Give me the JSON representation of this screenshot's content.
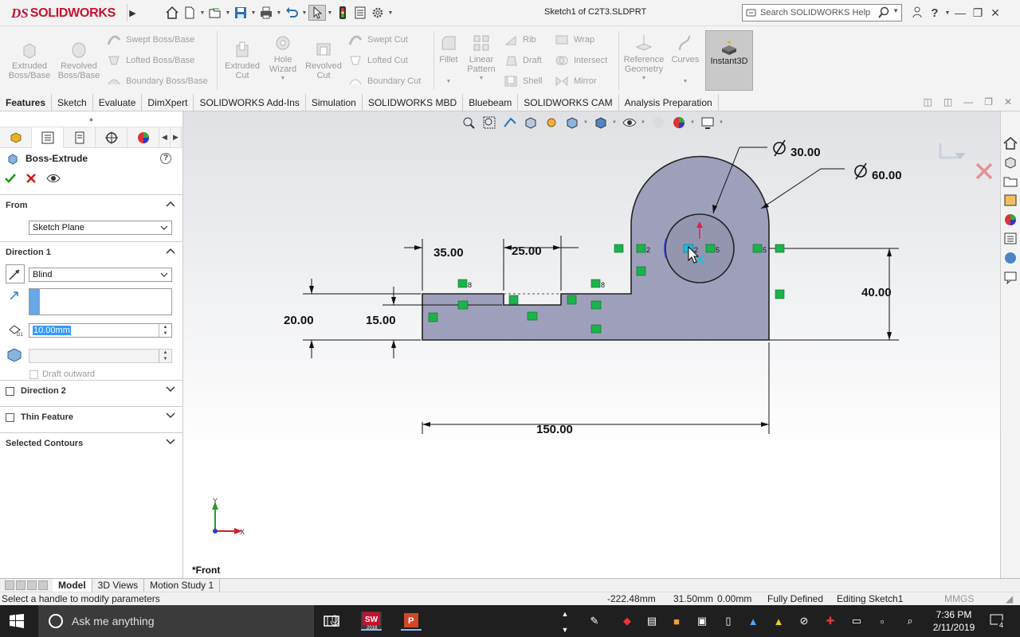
{
  "app": {
    "logo_prefix": "DS",
    "logo_text": "SOLIDWORKS",
    "document_title": "Sketch1 of C2T3.SLDPRT",
    "search_placeholder": "Search SOLIDWORKS Help"
  },
  "commands": {
    "extruded_boss": "Extruded Boss/Base",
    "revolved_boss": "Revolved Boss/Base",
    "swept_boss": "Swept Boss/Base",
    "lofted_boss": "Lofted Boss/Base",
    "boundary_boss": "Boundary Boss/Base",
    "extruded_cut": "Extruded Cut",
    "hole_wizard": "Hole Wizard",
    "revolved_cut": "Revolved Cut",
    "swept_cut": "Swept Cut",
    "lofted_cut": "Lofted Cut",
    "boundary_cut": "Boundary Cut",
    "fillet": "Fillet",
    "linear_pattern": "Linear Pattern",
    "rib": "Rib",
    "draft": "Draft",
    "shell": "Shell",
    "wrap": "Wrap",
    "intersect": "Intersect",
    "mirror": "Mirror",
    "reference_geometry": "Reference Geometry",
    "curves": "Curves",
    "instant3d": "Instant3D"
  },
  "tabs": [
    "Features",
    "Sketch",
    "Evaluate",
    "DimXpert",
    "SOLIDWORKS Add-Ins",
    "Simulation",
    "SOLIDWORKS MBD",
    "Bluebeam",
    "SOLIDWORKS CAM",
    "Analysis Preparation"
  ],
  "property_manager": {
    "title": "Boss-Extrude",
    "from_label": "From",
    "from_value": "Sketch Plane",
    "direction1_label": "Direction 1",
    "end_condition": "Blind",
    "depth": "10.00mm",
    "draft_outward": "Draft outward",
    "direction2_label": "Direction 2",
    "thin_feature_label": "Thin Feature",
    "selected_contours_label": "Selected Contours"
  },
  "sketch": {
    "dim_35": "35.00",
    "dim_25": "25.00",
    "dim_20": "20.00",
    "dim_15": "15.00",
    "dim_40": "40.00",
    "dim_150": "150.00",
    "dim_d30": "30.00",
    "dim_d60": "60.00",
    "relation_8a": "8",
    "relation_8b": "8",
    "relation_2a": "2",
    "relation_2b": "2",
    "relation_5a": "5",
    "relation_5b": "5",
    "view_label": "*Front",
    "triad_x": "X",
    "triad_y": "Y"
  },
  "bottom_tabs": [
    "Model",
    "3D Views",
    "Motion Study 1"
  ],
  "status": {
    "message": "Select a handle to modify parameters",
    "x": "-222.48mm",
    "y": "31.50mm",
    "z": "0.00mm",
    "state": "Fully Defined",
    "editing": "Editing Sketch1",
    "units": "MMGS"
  },
  "taskbar": {
    "search_placeholder": "Ask me anything",
    "sw_badge": "2018",
    "time": "7:36 PM",
    "date": "2/11/2019",
    "notifications": "4"
  },
  "colors": {
    "accent": "#c8102e",
    "sketch_fill": "#9ea0bb",
    "relation_green": "#1bb34a"
  }
}
